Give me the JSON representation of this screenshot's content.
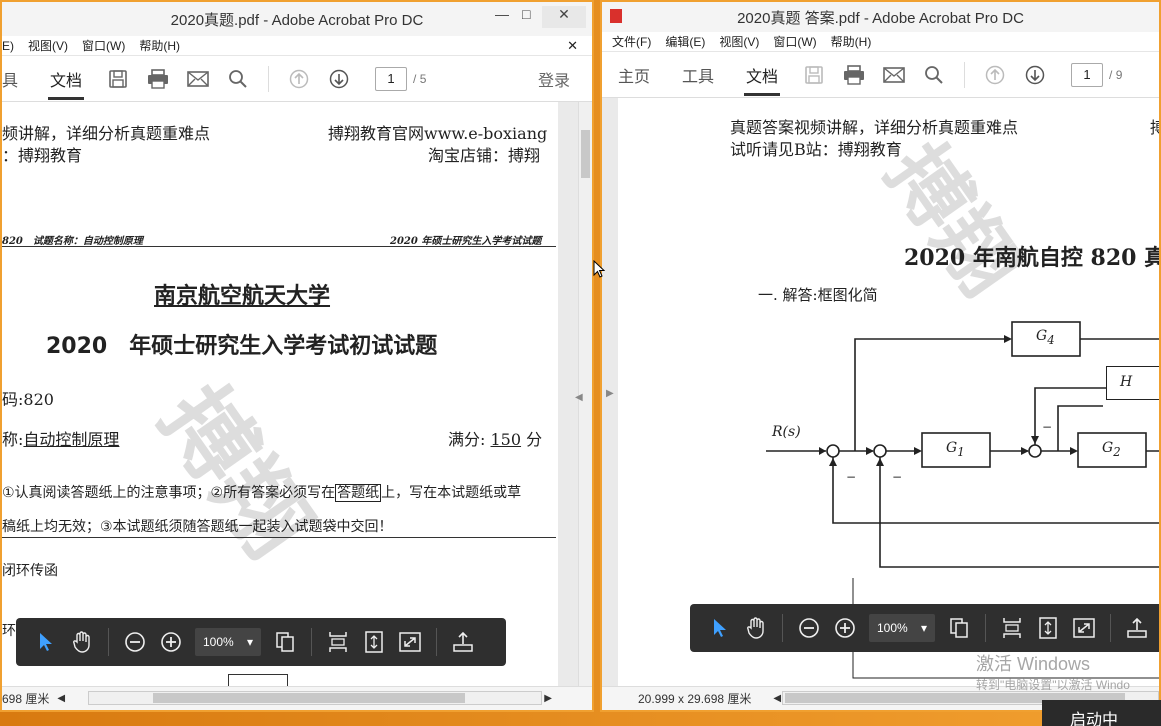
{
  "left_window": {
    "title": "2020真题.pdf - Adobe Acrobat Pro DC",
    "menus": [
      "E)",
      "视图(V)",
      "窗口(W)",
      "帮助(H)"
    ],
    "tabs": [
      "具",
      "文档"
    ],
    "login": "登录",
    "page_current": "1",
    "page_total": "/ 5",
    "status_size": "698 厘米",
    "zoom": "100%",
    "doc": {
      "banner_left_1": "频讲解，详细分析真题重难点",
      "banner_right_1": "搏翔教育官网www.e-boxiang",
      "banner_left_2": "：搏翔教育",
      "banner_right_2": "淘宝店铺：搏翔",
      "code_line": "820　试题名称：自动控制原理",
      "header_right": "2020 年硕士研究生入学考试试题",
      "university": "南京航空航天大学",
      "exam_title": "2020　年硕士研究生入学考试初试试题",
      "code": "码:820",
      "subject_label": "称:",
      "subject": "自动控制原理",
      "score_label": "满分:",
      "score": "150",
      "score_unit": "分",
      "notice_1a": "①认真阅读答题纸上的注意事项；②所有答案必须写在",
      "notice_1box": "答题纸",
      "notice_1b": "上，写在本试题纸或草",
      "notice_2": "稿纸上均无效；③本试题纸须随答题纸一起装入试题袋中交回！",
      "q1": "闭环传函",
      "q1b": "环"
    }
  },
  "right_window": {
    "title": "2020真题 答案.pdf - Adobe Acrobat Pro DC",
    "menus": [
      "文件(F)",
      "编辑(E)",
      "视图(V)",
      "窗口(W)",
      "帮助(H)"
    ],
    "tabs": [
      "主页",
      "工具",
      "文档"
    ],
    "page_current": "1",
    "page_total": "/ 9",
    "status_size": "20.999 x 29.698 厘米",
    "zoom": "100%",
    "doc": {
      "banner_left_1": "真题答案视频讲解，详细分析真题重难点",
      "banner_right_1": "搏",
      "banner_left_2": "试听请见B站：搏翔教育",
      "heading": "2020 年南航自控 820 真",
      "section": "一. 解答:框图化简",
      "labels": {
        "R": "R(s)",
        "G1": "G",
        "G1sub": "1",
        "G2": "G",
        "G2sub": "2",
        "G4": "G",
        "G4sub": "4",
        "H": "H",
        "minus": "−"
      }
    }
  },
  "overlay": {
    "activate_title": "激活 Windows",
    "activate_sub": "转到\"电脑设置\"以激活 Windo",
    "taskbar_button": "启动中"
  }
}
